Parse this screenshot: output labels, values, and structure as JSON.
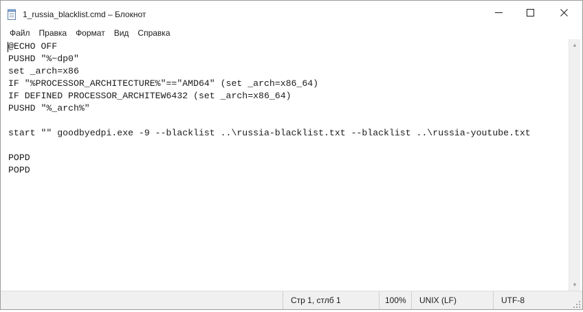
{
  "window": {
    "title": "1_russia_blacklist.cmd – Блокнот",
    "app_icon": "notepad-icon"
  },
  "menu": [
    {
      "label": "Файл"
    },
    {
      "label": "Правка"
    },
    {
      "label": "Формат"
    },
    {
      "label": "Вид"
    },
    {
      "label": "Справка"
    }
  ],
  "editor": {
    "lines": [
      "@ECHO OFF",
      "PUSHD \"%~dp0\"",
      "set _arch=x86",
      "IF \"%PROCESSOR_ARCHITECTURE%\"==\"AMD64\" (set _arch=x86_64)",
      "IF DEFINED PROCESSOR_ARCHITEW6432 (set _arch=x86_64)",
      "PUSHD \"%_arch%\"",
      "",
      "start \"\" goodbyedpi.exe -9 --blacklist ..\\russia-blacklist.txt --blacklist ..\\russia-youtube.txt",
      "",
      "POPD",
      "POPD"
    ]
  },
  "statusbar": {
    "position": "Стр 1, стлб 1",
    "zoom": "100%",
    "line_ending": "UNIX (LF)",
    "encoding": "UTF-8"
  },
  "colors": {
    "window_bg": "#ffffff",
    "statusbar_bg": "#f0f0f0",
    "text": "#1a1a1a"
  }
}
